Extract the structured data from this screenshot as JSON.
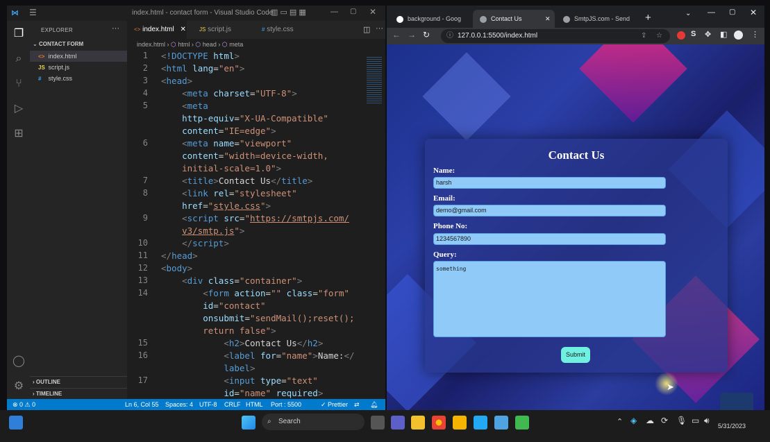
{
  "vscode": {
    "window_title": "index.html - contact form - Visual Studio Code",
    "explorer_header": "EXPLORER",
    "project": "CONTACT FORM",
    "files": [
      {
        "icon": "<>",
        "name": "index.html"
      },
      {
        "icon": "JS",
        "name": "script.js"
      },
      {
        "icon": "#",
        "name": "style.css"
      }
    ],
    "outline": "OUTLINE",
    "timeline": "TIMELINE",
    "tabs": [
      "index.html",
      "script.js",
      "style.css"
    ],
    "breadcrumb": [
      "index.html",
      "html",
      "head",
      "meta"
    ],
    "line_numbers": [
      "1",
      "2",
      "3",
      "4",
      "5",
      "",
      "",
      "6",
      "",
      "",
      "7",
      "8",
      "",
      "9",
      "",
      "10",
      "11",
      "12",
      "13",
      "14",
      "",
      "",
      "",
      "15",
      "16",
      "",
      "17",
      ""
    ],
    "status": {
      "errors": "⊗ 0 ⚠ 0",
      "position": "Ln 6, Col 55",
      "spaces": "Spaces: 4",
      "encoding": "UTF-8",
      "eol": "CRLF",
      "language": "HTML",
      "port": "Port : 5500",
      "prettier": "✓ Prettier"
    }
  },
  "browser": {
    "tabs": [
      "background - Goog",
      "Contact Us",
      "SmtpJS.com - Send"
    ],
    "url": "127.0.0.1:5500/index.html"
  },
  "form": {
    "title": "Contact Us",
    "name_label": "Name:",
    "name_value": "harsh",
    "email_label": "Email:",
    "email_value": "demo@gmail.com",
    "phone_label": "Phone No:",
    "phone_value": "1234567890",
    "query_label": "Query:",
    "query_value": "something",
    "submit": "Submit"
  },
  "taskbar": {
    "search": "Search",
    "date": "5/31/2023"
  },
  "colors": {
    "vscode_status": "#007acc",
    "form_input": "#90caf9",
    "submit_button": "#6ff0e0"
  }
}
